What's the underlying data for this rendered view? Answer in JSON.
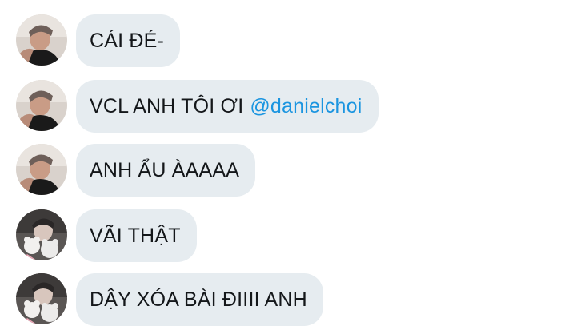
{
  "messages": [
    {
      "avatar": "user-a",
      "text": "CÁI ĐÉ-",
      "mention": ""
    },
    {
      "avatar": "user-a",
      "text": "VCL ANH TÔI ƠI",
      "mention": "@danielchoi"
    },
    {
      "avatar": "user-a",
      "text": "ANH ẨU ÀAAAA",
      "mention": ""
    },
    {
      "avatar": "user-b",
      "text": "VÃI THẬT",
      "mention": ""
    },
    {
      "avatar": "user-b",
      "text": "DẬY XÓA BÀI ĐIIII ANH",
      "mention": ""
    }
  ],
  "colors": {
    "bubble": "#e6ecf0",
    "text": "#14171a",
    "mention": "#1b95e0"
  },
  "icons": {
    "avatar": "profile-photo"
  }
}
